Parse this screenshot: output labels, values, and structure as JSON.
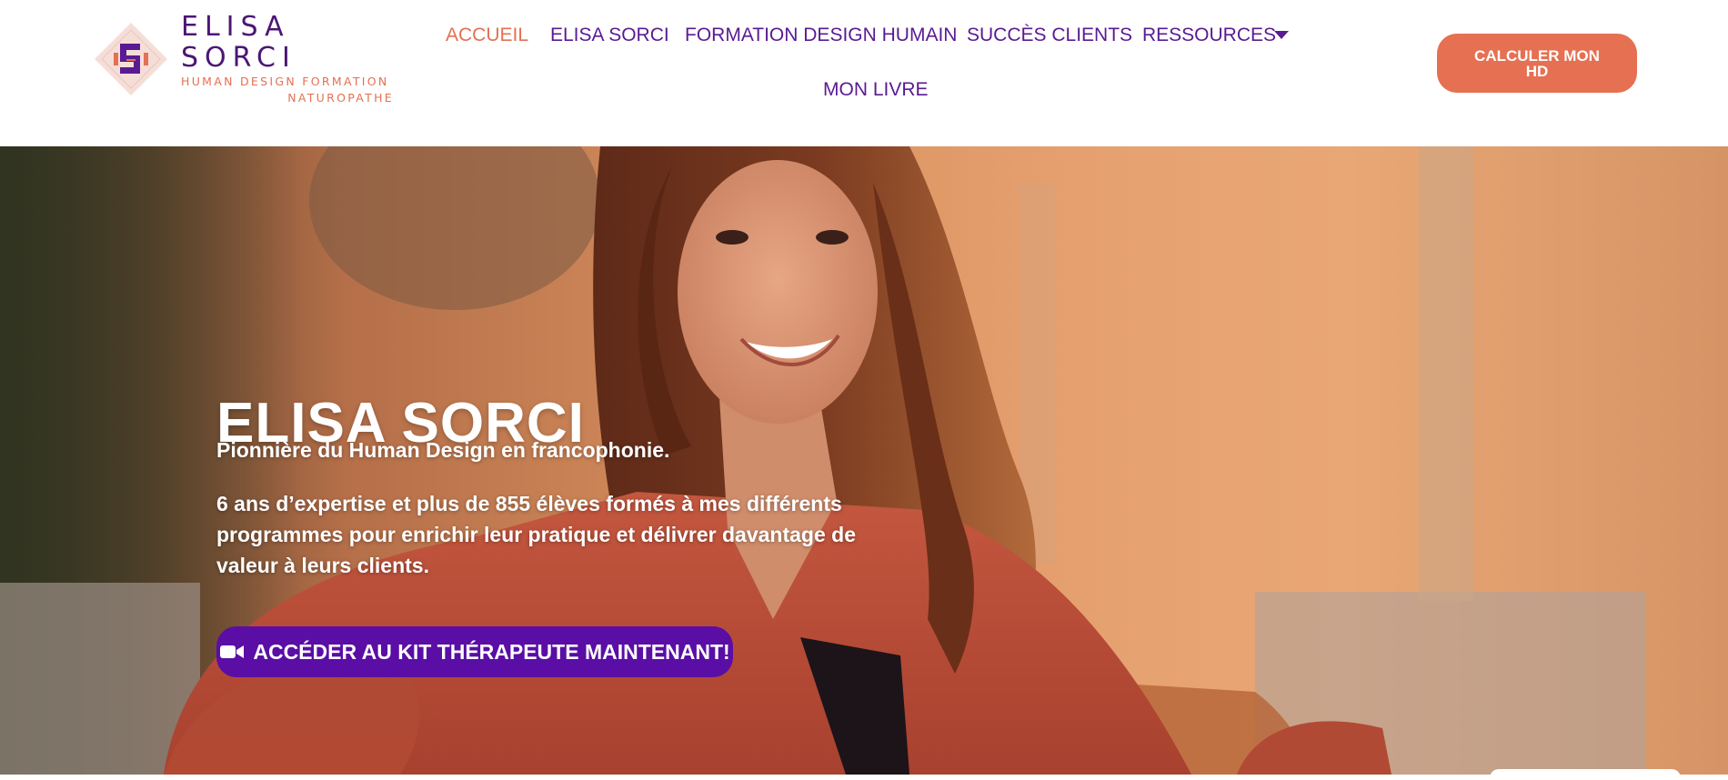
{
  "brand": {
    "name": "ELISA SORCI",
    "subtitle": "HUMAN DESIGN FORMATION",
    "subtitle2": "NATUROPATHE",
    "colors": {
      "primary": "#5a1a93",
      "accent": "#e57052",
      "cta": "#5a0ea5"
    }
  },
  "nav": {
    "items": [
      {
        "label": "ACCUEIL",
        "active": true
      },
      {
        "label": "ELISA SORCI"
      },
      {
        "label": "FORMATION DESIGN HUMAIN"
      },
      {
        "label": "SUCCÈS CLIENTS"
      },
      {
        "label": "RESSOURCES",
        "icon": "caret-down-icon"
      },
      {
        "label": "MON LIVRE"
      }
    ],
    "cta_label": "CALCULER MON HD"
  },
  "hero": {
    "title": "ELISA SORCI",
    "tagline": "Pionnière du Human Design en francophonie.",
    "description": "6 ans d’expertise et plus de 855 élèves formés à mes différents programmes pour enrichir leur pratique et délivrer davantage de valeur à leurs clients.",
    "cta_icon": "video-camera-icon",
    "cta_label": "ACCÉDER AU KIT THÉRAPEUTE MAINTENANT!"
  }
}
